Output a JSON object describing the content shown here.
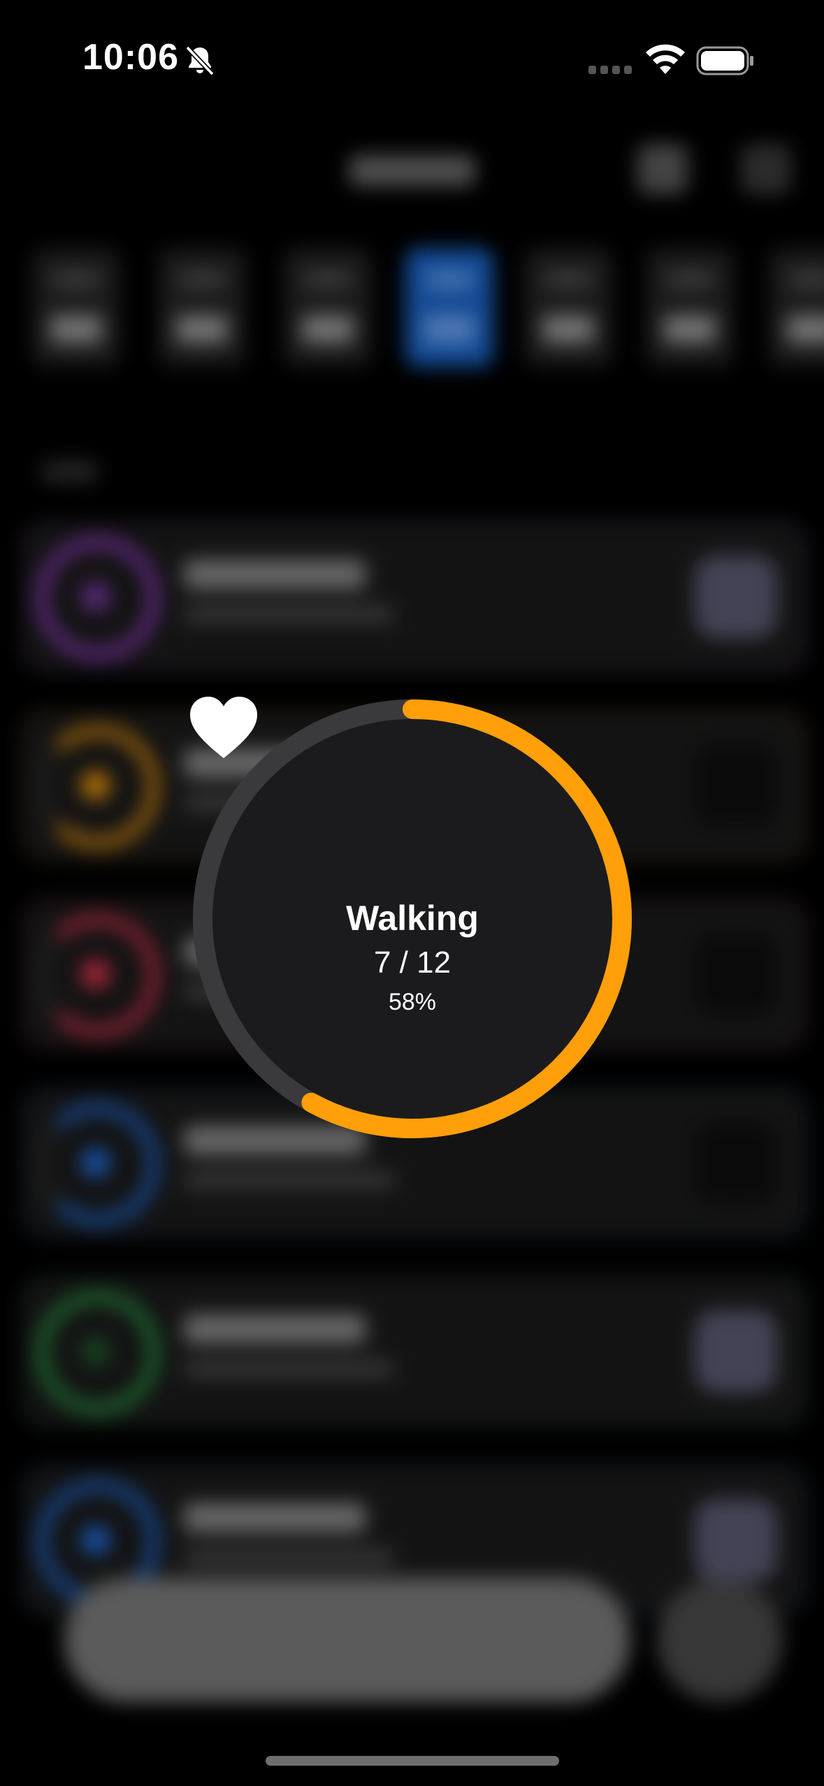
{
  "status_bar": {
    "time": "10:06"
  },
  "focus": {
    "habit_name": "Walking",
    "count_text": "7 / 12",
    "percent_text": "58%",
    "progress": 0.58,
    "accent_color": "#FF9F0A",
    "track_color": "#3a3a3c",
    "icon": "heart-icon"
  },
  "background_colors": {
    "cards": [
      "#9b3fd0",
      "#f29a0e",
      "#e0344f",
      "#1f6fe0",
      "#2aa348",
      "#1f6fe0"
    ],
    "selected_day": "#1a63c6"
  }
}
